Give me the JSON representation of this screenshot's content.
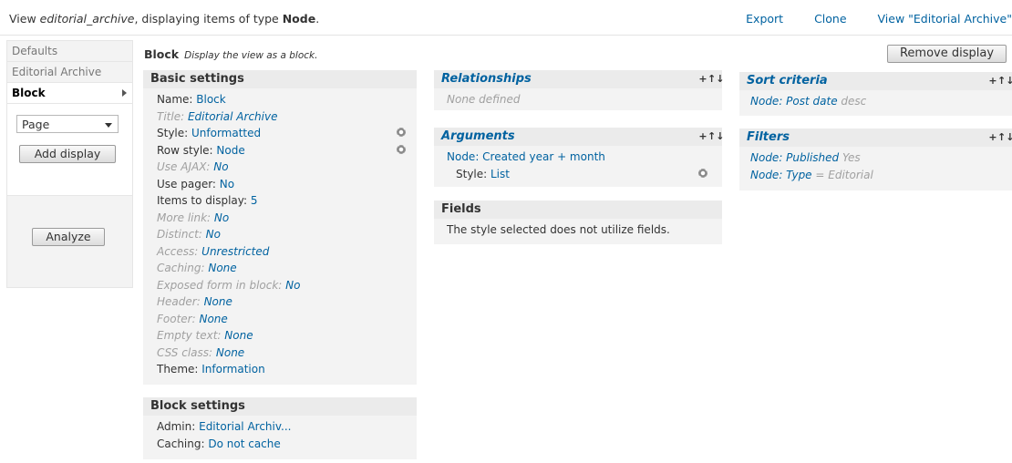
{
  "header": {
    "desc_prefix": "View ",
    "view_name": "editorial_archive",
    "desc_middle": ", displaying items of type ",
    "type": "Node",
    "desc_end": ".",
    "links": [
      "Export",
      "Clone",
      "View \"Editorial Archive\""
    ]
  },
  "tabs": {
    "items": [
      "Defaults",
      "Editorial Archive",
      "Block"
    ],
    "select_value": "Page",
    "add_display": "Add display",
    "analyze": "Analyze"
  },
  "display": {
    "name": "Block",
    "description": "Display the view as a block.",
    "remove": "Remove display"
  },
  "basic": {
    "title": "Basic settings",
    "rows": [
      {
        "label": "Name: ",
        "value": "Block",
        "dim": false,
        "gear": false
      },
      {
        "label": "Title: ",
        "value": "Editorial Archive",
        "dim": true,
        "gear": false
      },
      {
        "label": "Style: ",
        "value": "Unformatted",
        "dim": false,
        "gear": true
      },
      {
        "label": "Row style: ",
        "value": "Node",
        "dim": false,
        "gear": true
      },
      {
        "label": "Use AJAX: ",
        "value": "No",
        "dim": true,
        "gear": false
      },
      {
        "label": "Use pager: ",
        "value": "No",
        "dim": false,
        "gear": false
      },
      {
        "label": "Items to display: ",
        "value": "5",
        "dim": false,
        "gear": false
      },
      {
        "label": "More link: ",
        "value": "No",
        "dim": true,
        "gear": false
      },
      {
        "label": "Distinct: ",
        "value": "No",
        "dim": true,
        "gear": false
      },
      {
        "label": "Access: ",
        "value": "Unrestricted",
        "dim": true,
        "gear": false
      },
      {
        "label": "Caching: ",
        "value": "None",
        "dim": true,
        "gear": false
      },
      {
        "label": "Exposed form in block: ",
        "value": "No",
        "dim": true,
        "gear": false
      },
      {
        "label": "Header: ",
        "value": "None",
        "dim": true,
        "gear": false
      },
      {
        "label": "Footer: ",
        "value": "None",
        "dim": true,
        "gear": false
      },
      {
        "label": "Empty text: ",
        "value": "None",
        "dim": true,
        "gear": false
      },
      {
        "label": "CSS class: ",
        "value": "None",
        "dim": true,
        "gear": false
      },
      {
        "label": "Theme: ",
        "value": "Information",
        "dim": false,
        "gear": false
      }
    ]
  },
  "block_settings": {
    "title": "Block settings",
    "admin_label": "Admin: ",
    "admin_value": "Editorial Archiv...",
    "caching_label": "Caching: ",
    "caching_value": "Do not cache"
  },
  "relationships": {
    "title": "Relationships",
    "empty": "None defined"
  },
  "arguments": {
    "title": "Arguments",
    "item": "Node: Created year + month",
    "style_label": "Style: ",
    "style_value": "List"
  },
  "fields": {
    "title": "Fields",
    "note": "The style selected does not utilize fields."
  },
  "sort": {
    "title": "Sort criteria",
    "item": "Node: Post date",
    "suffix": " desc"
  },
  "filters": {
    "title": "Filters",
    "item1": "Node: Published",
    "item1_suffix": " Yes",
    "item2": "Node: Type",
    "item2_suffix": " = Editorial"
  },
  "icons": {
    "add": "+",
    "rearrange": "↑↓"
  }
}
